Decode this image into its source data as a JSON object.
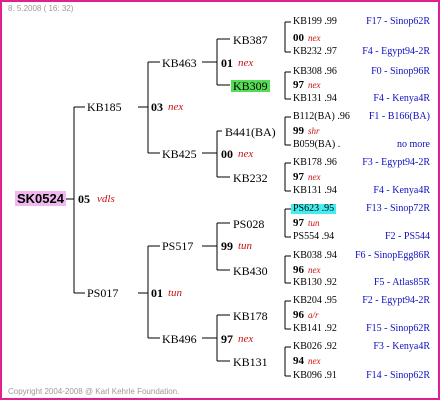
{
  "header": {
    "timestamp": "8. 5.2008 ( 16: 32)"
  },
  "footer": {
    "copyright": "Copyright 2004-2008 @ Karl Kehrle Foundation."
  },
  "colors": {
    "border": "#e0208e",
    "root_bg": "#f0b8f0",
    "code": "#cc1111",
    "right_text": "#1010c0",
    "line": "#000000"
  },
  "pedigree": {
    "root": {
      "id": "SK0524",
      "num": "05",
      "code": "vdls"
    },
    "gen1": {
      "top": {
        "id": "KB185",
        "num": "03",
        "code": "nex"
      },
      "bottom": {
        "id": "PS017",
        "num": "01",
        "code": "tun"
      }
    },
    "gen2": {
      "kb463": {
        "id": "KB463",
        "num": "01",
        "code": "nex"
      },
      "kb425": {
        "id": "KB425",
        "num": "00",
        "code": "nex"
      },
      "ps517": {
        "id": "PS517",
        "num": "99",
        "code": "tun"
      },
      "kb496": {
        "id": "KB496",
        "num": "97",
        "code": "nex"
      }
    },
    "gen3": {
      "kb387": {
        "id": "KB387",
        "num": "00",
        "code": "nex"
      },
      "kb309": {
        "id": "KB309",
        "num": "97",
        "code": "nex"
      },
      "b441": {
        "id": "B441(BA)",
        "num": "99",
        "code": "shr"
      },
      "kb232": {
        "id": "KB232",
        "num": "97",
        "code": "nex"
      },
      "ps028": {
        "id": "PS028",
        "num": "97",
        "code": "tun"
      },
      "kb430": {
        "id": "KB430",
        "num": "96",
        "code": "nex"
      },
      "kb178": {
        "id": "KB178",
        "num": "96",
        "code": "a/r"
      },
      "kb131": {
        "id": "KB131",
        "num": "94",
        "code": "nex"
      }
    },
    "gen4": [
      {
        "id": "KB199 .99",
        "right": "F17 - Sinop62R"
      },
      {
        "id": "KB232 .97",
        "right": "F4 - Egypt94-2R"
      },
      {
        "id": "KB308 .96",
        "right": "F0 - Sinop96R"
      },
      {
        "id": "KB131 .94",
        "right": "F4 - Kenya4R"
      },
      {
        "id": "B112(BA) .96",
        "right": "F1 - B166(BA)"
      },
      {
        "id": "B059(BA) .",
        "right": "no more"
      },
      {
        "id": "KB178 .96",
        "right": "F3 - Egypt94-2R"
      },
      {
        "id": "KB131 .94",
        "right": "F4 - Kenya4R"
      },
      {
        "id": "PS623 .95",
        "right": "F13 - Sinop72R"
      },
      {
        "id": "PS554 .94",
        "right": "F2 - PS544"
      },
      {
        "id": "KB038 .94",
        "right": "F6 - SinopEgg86R"
      },
      {
        "id": "KB130 .92",
        "right": "F5 - Atlas85R"
      },
      {
        "id": "KB204 .95",
        "right": "F2 - Egypt94-2R"
      },
      {
        "id": "KB141 .92",
        "right": "F15 - Sinop62R"
      },
      {
        "id": "KB026 .92",
        "right": "F3 - Kenya4R"
      },
      {
        "id": "KB096 .91",
        "right": "F14 - Sinop62R"
      }
    ]
  }
}
